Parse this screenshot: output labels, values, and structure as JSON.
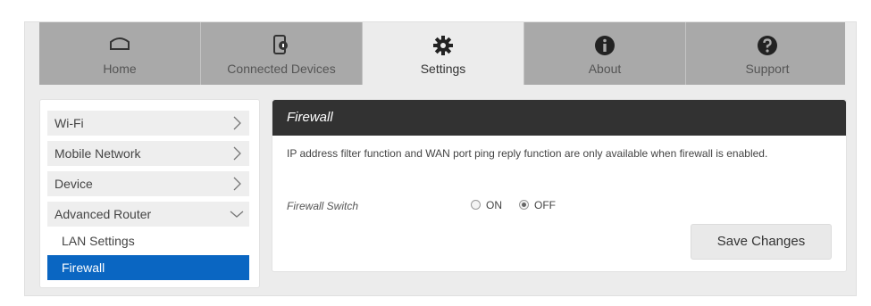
{
  "nav": {
    "items": [
      {
        "label": "Home",
        "icon": "home-icon"
      },
      {
        "label": "Connected Devices",
        "icon": "devices-icon"
      },
      {
        "label": "Settings",
        "icon": "gear-icon",
        "active": true
      },
      {
        "label": "About",
        "icon": "info-icon"
      },
      {
        "label": "Support",
        "icon": "help-icon"
      }
    ]
  },
  "sidebar": {
    "items": [
      {
        "label": "Wi-Fi"
      },
      {
        "label": "Mobile Network"
      },
      {
        "label": "Device"
      },
      {
        "label": "Advanced Router",
        "expanded": true
      }
    ],
    "subitems": [
      {
        "label": "LAN Settings"
      },
      {
        "label": "Firewall",
        "active": true
      }
    ]
  },
  "panel": {
    "title": "Firewall",
    "notice": "IP address filter function and WAN port ping reply function are only available when firewall is enabled.",
    "switch_label": "Firewall Switch",
    "option_on": "ON",
    "option_off": "OFF",
    "selected": "OFF",
    "save_label": "Save Changes"
  },
  "colors": {
    "nav_bg": "#a9a9a9",
    "header_bg": "#323232",
    "active_sub": "#0a66c2"
  }
}
